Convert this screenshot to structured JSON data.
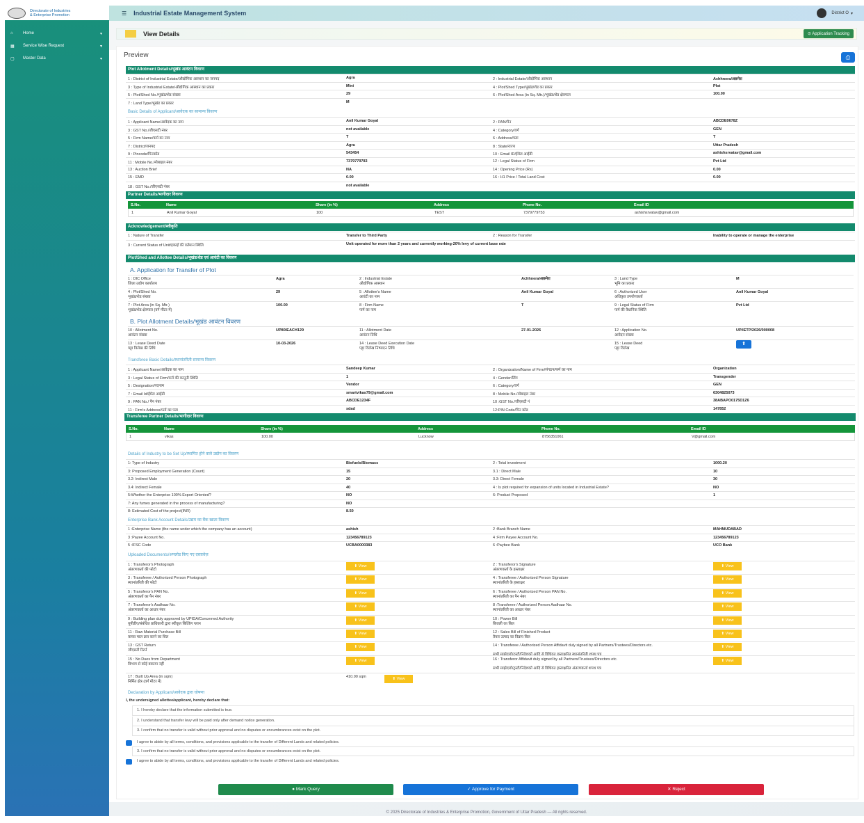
{
  "app": {
    "org_line1": "Directorate of Industries",
    "org_line2": "& Enterprise Promotion",
    "system_title": "Industrial Estate Management System",
    "user": "District O"
  },
  "sidebar": [
    {
      "icon": "home-icon",
      "label": "Home"
    },
    {
      "icon": "grid-icon",
      "label": "Service Wise Request"
    },
    {
      "icon": "folder-icon",
      "label": "Master Data"
    }
  ],
  "header": {
    "title": "View Details",
    "tracking": "Application Tracking",
    "preview": "Preview"
  },
  "sections": {
    "plot": "Plot Allotment Details/भूखंड आवंटन विवरण",
    "basic": "Basic Details of Applicant/आवेदक का सामान्य विवरण",
    "partner": "Partner Details/भागीदार विवरण",
    "ack": "Acknowledgement/स्वीकृति",
    "shed": "Plot/Shed and Allottee Details/भूखंड/शेड एवं आवंटी का विवरण",
    "transfer_a": "A. Application for Transfer of Plot",
    "transfer_b": "B. Plot Allotment Details/भूखंड आवंटन विवरण",
    "transferee": "Transferee Basic Details/स्थानांतरिती सामान्य विवरण",
    "tpartner": "Transferee Partner Details/भागीदार विवरण",
    "industry": "Details of Industry to be Set Up/स्थापित होने वाले उद्योग का विवरण",
    "bank": "Enterprise Bank Account Details/उद्यम का बैंक खाता विवरण",
    "docs": "Uploaded Documents/अपलोड किए गए दस्तावेज़",
    "declaration": "Declaration by Applicant/आवेदक द्वारा घोषणा"
  },
  "plot_rows": [
    [
      "1 : District of Industrial Estate/औद्योगिक आस्थान का जनपद",
      "Agra",
      "2 : Industrial Estate/औद्योगिक आस्थान",
      "Achhnera/अछनेरा"
    ],
    [
      "3 : Type of Industrial Estate/औद्योगिक आस्थान का प्रकार",
      "Mini",
      "4 : Plot/Shed Type/भूखंड/शेड का प्रकार",
      "Plot"
    ],
    [
      "5 : Plot/Shed No./भूखंड/शेड संख्या",
      "29",
      "6 : Plot/Shed Area (in Sq. Mtr.)/भूखंड/शेड क्षेत्रफल",
      "100.00"
    ],
    [
      "7 : Land Type/भूखंड का प्रकार",
      "M",
      "",
      ""
    ]
  ],
  "basic_rows": [
    [
      "1 : Applicant Name/आवेदक का नाम",
      "Anil Kumar Goyal",
      "2 : PAN/पैन",
      "ABCDE0678Z"
    ],
    [
      "3 : GST No./जीएसटी नंबर",
      "not available",
      "4 : Category/वर्ग",
      "GEN"
    ],
    [
      "5 : Firm Name/फर्म का नाम",
      "T",
      "6 : Address/पता",
      "T"
    ],
    [
      "7 : District/जनपद",
      "Agra",
      "8 : State/राज्य",
      "Uttar Pradesh"
    ],
    [
      "9 : Pincode/पिनकोड",
      "543454",
      "10 : Email ID/ईमेल आईडी",
      "ashishsrvatav@gmail.com"
    ],
    [
      "11 : Mobile No./मोबाइल नंबर",
      "7379779783",
      "12 : Legal Status of Firm",
      "Pvt Ltd"
    ],
    [
      "13 : Auction Brief",
      "NA",
      "14 : Opening Price (Rs)",
      "0.00"
    ],
    [
      "15 : EMD",
      "0.00",
      "16 : H1 Price / Total Land Cost",
      "0.00"
    ],
    [
      "18 : GST No./जीएसटी नंबर",
      "not available",
      "",
      ""
    ]
  ],
  "partner_table": {
    "headers": [
      "S.No.",
      "Name",
      "Share (in %)",
      "Address",
      "Phone No.",
      "Email ID"
    ],
    "rows": [
      [
        "1",
        "Anil Kumar Goyal",
        "100",
        "TEST",
        "7379779753",
        "ashishsrvatav@gmail.com"
      ]
    ]
  },
  "ack_rows": [
    [
      "1 : Nature of Transfer",
      "Transfer to Third Party",
      "2 : Reason for Transfer",
      "Inability to operate or manage the enterprise"
    ],
    [
      "3 : Current Status of Unit/इकाई की वर्तमान स्थिति",
      "Unit operated for more than 2 years and currently working-20% levy of current base rate",
      "",
      ""
    ]
  ],
  "transfer_a_rows": [
    [
      "1 : DIC Office",
      "जिला उद्योग कार्यालय",
      "Agra",
      "2 : Industrial Estate",
      "औद्योगिक आस्थान",
      "Achhnera/अछनेरा",
      "3 : Land Type",
      "भूमि का प्रकार",
      "M"
    ],
    [
      "4 : Plot/Shed No.",
      "भूखंड/शेड संख्या",
      "29",
      "5 : Allottee's Name",
      "आवंटी का नाम",
      "Anil Kumar Goyal",
      "6 : Authorized User",
      "अधिकृत उपयोगकर्ता",
      "Anil Kumar Goyal"
    ],
    [
      "7 : Plot Area (in Sq. Mtr.)",
      "भूखंड/शेड क्षेत्रफल (वर्ग मीटर में)",
      "100.00",
      "8 : Firm Name",
      "फर्म का नाम",
      "T",
      "9 : Legal Status of Firm",
      "फर्म की वैधानिक स्थिति",
      "Pvt Ltd"
    ]
  ],
  "transfer_b_rows": [
    [
      "10 : Allotment No.",
      "आवंटन संख्या",
      "UP80IEACH129",
      "11 : Allotment Date",
      "आवंटन तिथि",
      "27-01-2026",
      "12 : Application No.",
      "आवेदन संख्या",
      "UP/IETP/2026/000008"
    ],
    [
      "13 : Lease Deed Date",
      "पट्टा विलेख की तिथि",
      "10-03-2026",
      "14 : Lease Deed Execution Date",
      "पट्टा विलेख निष्पादन तिथि",
      "",
      "15 : Lease Deed",
      "पट्टा विलेख",
      ""
    ]
  ],
  "transferee_rows": [
    [
      "1 : Applicant Name/आवेदक का नाम",
      "Sandeep Kumar",
      "2 : Organization/Name of Firm/संगठन/फर्म का नाम",
      "Organization"
    ],
    [
      "3 : Legal Status of Firm/फर्म की कानूनी स्थिति",
      "1",
      "4 : Gender/लिंग",
      "Transgender"
    ],
    [
      "5 : Designation/पदनाम",
      "Vendor",
      "6 : Category/वर्ग",
      "GEN"
    ],
    [
      "7 : Email Id/ईमेल आईडी",
      "smartvikas79@gmail.com",
      "8 : Mobile No./मोबाइल नंबर",
      "6304825073"
    ],
    [
      "9 : PAN No./ पैन नंबर",
      "ABCDE1234F",
      "10 :GST No./जीएसटी नं",
      "38ABAPO0175D1Z6"
    ],
    [
      "11 : Firm's Address/फर्म का पता",
      "sdad",
      "12:PIN Code/पिन कोड",
      "147852"
    ]
  ],
  "tpartner_table": {
    "headers": [
      "S.No.",
      "Name",
      "Share (in %)",
      "Address",
      "Phone No.",
      "Email ID"
    ],
    "rows": [
      [
        "1",
        "vikas",
        "100.00",
        "Lucknow",
        "8756351061",
        "V@gmail.com"
      ]
    ]
  },
  "industry_rows": [
    [
      "1: Type of Industry",
      "Biofuels/Biomass",
      "2 : Total investment",
      "1000.20"
    ],
    [
      "3: Proposed Employment Generation (Count)",
      "15",
      "3.1 : Direct Male",
      "10"
    ],
    [
      "3.2: Indirect Male",
      "20",
      "3.3: Direct Female",
      "30"
    ],
    [
      "3.4: Indirect Female",
      "40",
      "4 : Is plot required for expansion of units located in Industrial Estate?",
      "NO"
    ],
    [
      "5:Whether the Enterprise 100% Export Oriented?",
      "NO",
      "6: Product Proposed",
      "1"
    ],
    [
      "7: Any fumes generated in the process of manufacturing?",
      "NO",
      "",
      ""
    ],
    [
      "8: Estimated Cost of the project(INR)",
      "8.50",
      "",
      ""
    ]
  ],
  "bank_rows": [
    [
      "1 :Enterprise Name (the name under which the company has an account)",
      "ashish",
      "2 :Bank Branch Name",
      "MAHMUDABAD"
    ],
    [
      "3 :Payee Account No.",
      "123456789123",
      "4 :Firm Payee Account No.",
      "123456789123"
    ],
    [
      "5 :IFSC Code",
      "UCBA0000383",
      "6 :Paybee Bank",
      "UCO Bank"
    ]
  ],
  "docs": [
    [
      "1 : Transferor's Photograph",
      "अंतरणकर्ता की फोटो",
      "2 : Transferor's Signature",
      "अंतरणकर्ता के हस्ताक्षर"
    ],
    [
      "3 : Transferee / Authorized Person Photograph",
      "स्थानांतरिती की फोटो",
      "4 : Transferee / Authorized Person Signature",
      "स्थानांतरिती के हस्ताक्षर"
    ],
    [
      "5 : Transferor's PAN No.",
      "अंतरणकर्ता का पैन नंबर",
      "6 : Transferee / Authorized Person PAN No.",
      "स्थानांतरिती का पैन नंबर"
    ],
    [
      "7 : Transferor's Aadhaar No.",
      "अंतरणकर्ता का आधार नंबर",
      "8 :Transferee / Authorized Person Aadhaar No.",
      "स्थानांतरिती का आधार नंबर"
    ],
    [
      "9 : Building plan duly approved by UPIDA/Concerned Authority",
      "यूपीडीए/संबंधित प्राधिकारी द्वारा स्वीकृत बिल्डिंग प्लान",
      "10 : Power Bill",
      "बिजली का बिल"
    ],
    [
      "11 : Raw Material Purchase Bill",
      "कच्चा माल क्रय करने का बिल",
      "12 : Sales Bill of Finished Product",
      "तैयार उत्पाद का विक्रय बिल"
    ],
    [
      "13 : GST Return",
      "जीएसटी रिटर्न",
      "14 : Transferee / Authorized Person Affidavit duly signed by all Partners/Trustees/Directors etc.",
      "सभी साझेदारों/ट्रस्टी/निदेशकों आदि से विधिवत हस्ताक्षरित स्थानांतरिती शपथ पत्र"
    ],
    [
      "15 : No Dues from Department",
      "विभाग से कोई बकाया नहीं",
      "16 : Transferor Affidavit duly signed by all Partners/Trustees/Directors etc.",
      "सभी साझेदारों/ट्रस्टी/निदेशकों आदि से विधिवत हस्ताक्षरित अंतरणकर्ता शपथ पत्र"
    ]
  ],
  "builtup": {
    "label": "17 : Built Up Area (in sqm)",
    "label_hi": "निर्मित क्षेत्र (वर्ग मीटर में)",
    "value": "410.00 sqm"
  },
  "view_label": "View",
  "declaration": {
    "intro": "I, the undersigned allottee/applicant, hereby declare that:",
    "items": [
      "1. I hereby declare that the information submitted is true.",
      "2. I understand that transfer levy will be paid only after demand notice generation.",
      "3. I confirm that no transfer is valid without prior approval and no disputes or encumbrances exist on the plot."
    ],
    "agree1": "I agree to abide by all terms, conditions, and provisions applicable to the transfer of Different Lands and related policies.",
    "item3b": "3. I confirm that no transfer is valid without prior approval and no disputes or encumbrances exist on the plot.",
    "agree2": "I agree to abide by all terms, conditions, and provisions applicable to the transfer of Different Lands and related policies."
  },
  "actions": {
    "query": "Mark Query",
    "approve": "Approve for Payment",
    "reject": "Reject"
  },
  "colors": {
    "section": "#138a6d",
    "table_header": "#14953a",
    "view": "#f8c21b",
    "query": "#1f8a4c",
    "approve": "#1673d8",
    "reject": "#d9233b"
  },
  "footer": "© 2025 Directorate of Industries & Enterprise Promotion, Government of Uttar Pradesh — All rights reserved."
}
